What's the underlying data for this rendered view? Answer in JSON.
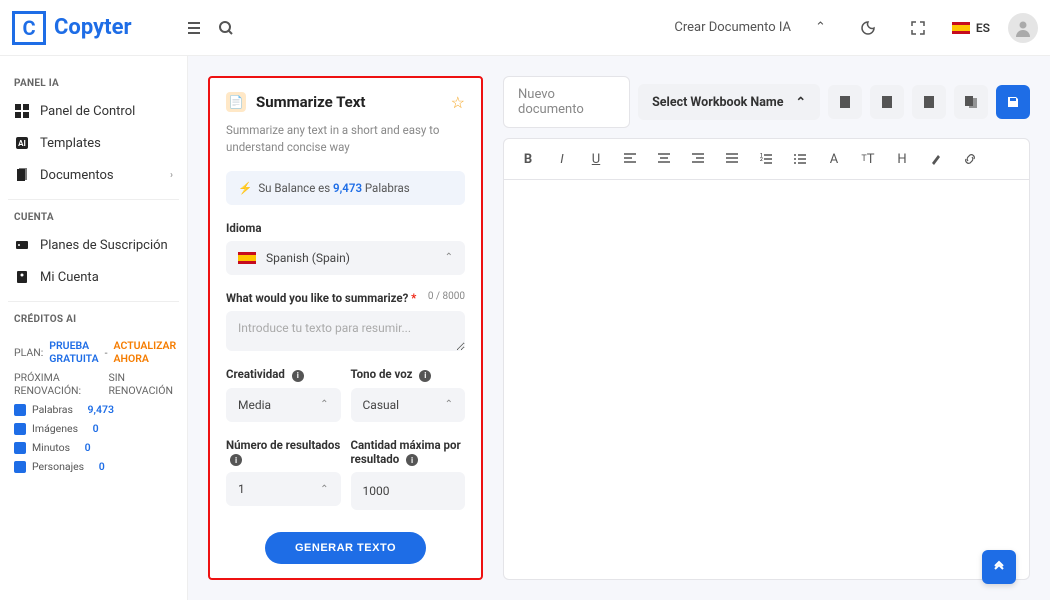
{
  "brand": {
    "mark": "C",
    "name": "Copyter"
  },
  "topbar": {
    "crear_doc": "Crear Documento IA",
    "lang_code": "ES"
  },
  "sidebar": {
    "heading_panel": "PANEL IA",
    "items_panel": [
      {
        "label": "Panel de Control"
      },
      {
        "label": "Templates"
      },
      {
        "label": "Documentos",
        "has_sub": true
      }
    ],
    "heading_account": "CUENTA",
    "items_account": [
      {
        "label": "Planes de Suscripción"
      },
      {
        "label": "Mi Cuenta"
      }
    ],
    "heading_credits": "CRÉDITOS AI",
    "plan_label": "PLAN:",
    "plan_name": "PRUEBA GRATUITA",
    "plan_sep": " - ",
    "plan_upgrade": "ACTUALIZAR AHORA",
    "renewal_label": "PRÓXIMA RENOVACIÓN:",
    "renewal_value": "SIN RENOVACIÓN",
    "credit_rows": [
      {
        "label": "Palabras",
        "value": "9,473"
      },
      {
        "label": "Imágenes",
        "value": "0"
      },
      {
        "label": "Minutos",
        "value": "0"
      },
      {
        "label": "Personajes",
        "value": "0"
      }
    ]
  },
  "form": {
    "title": "Summarize Text",
    "desc": "Summarize any text in a short and easy to understand concise way",
    "balance_prefix": "Su Balance es ",
    "balance_value": "9,473",
    "balance_suffix": " Palabras",
    "lang_label": "Idioma",
    "lang_value": "Spanish (Spain)",
    "summarize_label": "What would you like to summarize?",
    "summarize_counter": "0 / 8000",
    "summarize_placeholder": "Introduce tu texto para resumir...",
    "creativity_label": "Creatividad",
    "creativity_value": "Media",
    "tone_label": "Tono de voz",
    "tone_value": "Casual",
    "results_label": "Número de resultados",
    "results_value": "1",
    "maxlen_label": "Cantidad máxima por resultado",
    "maxlen_value": "1000",
    "generate": "GENERAR TEXTO"
  },
  "editor": {
    "doc_name": "Nuevo documento",
    "workbook": "Select Workbook Name"
  }
}
